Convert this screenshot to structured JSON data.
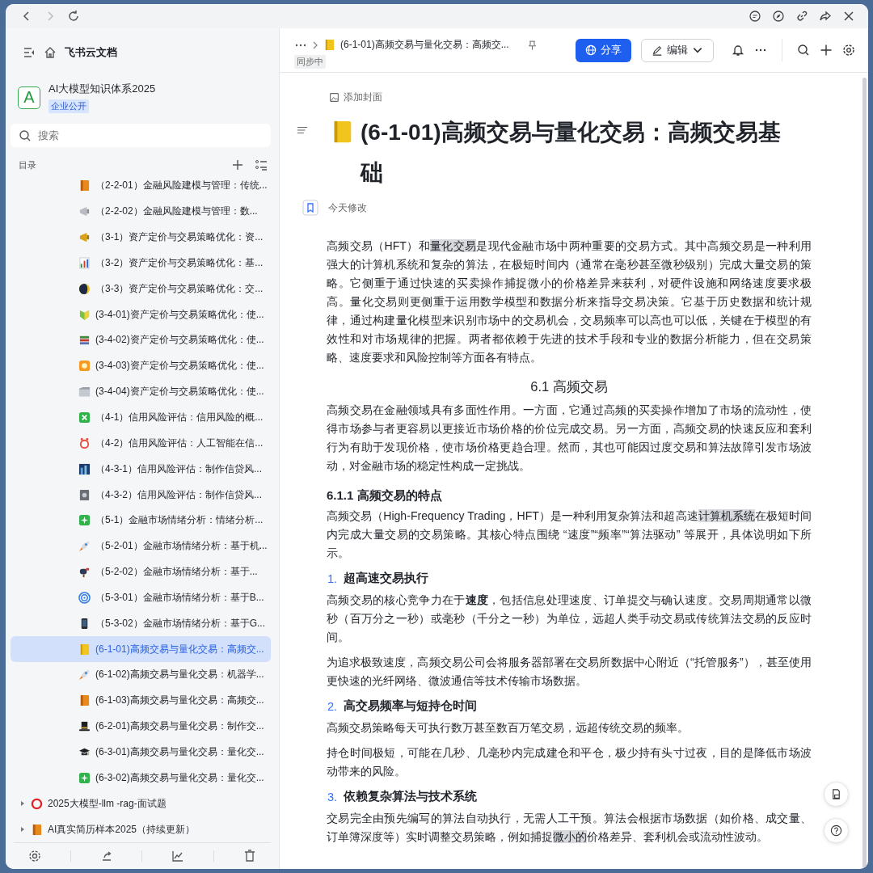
{
  "sidebar": {
    "app_title": "飞书云文档",
    "space": {
      "avatar": "A",
      "name": "AI大模型知识体系2025",
      "badge": "企业公开"
    },
    "search": {
      "placeholder": "搜索"
    },
    "toc_label": "目录",
    "items": [
      {
        "label": "（2-2-01）金融风险建模与管理：传统...",
        "selected": false
      },
      {
        "label": "（2-2-02）金融风险建模与管理：数...",
        "selected": false
      },
      {
        "label": "（3-1）资产定价与交易策略优化：资...",
        "selected": false
      },
      {
        "label": "（3-2）资产定价与交易策略优化：基...",
        "selected": false
      },
      {
        "label": "（3-3）资产定价与交易策略优化：交...",
        "selected": false
      },
      {
        "label": "(3-4-01)资产定价与交易策略优化：使...",
        "selected": false
      },
      {
        "label": "(3-4-02)资产定价与交易策略优化：使...",
        "selected": false
      },
      {
        "label": "(3-4-03)资产定价与交易策略优化：使...",
        "selected": false
      },
      {
        "label": "(3-4-04)资产定价与交易策略优化：使...",
        "selected": false
      },
      {
        "label": "（4-1）信用风险评估：信用风险的概...",
        "selected": false
      },
      {
        "label": "（4-2）信用风险评估：人工智能在信...",
        "selected": false
      },
      {
        "label": "（4-3-1）信用风险评估：制作信贷风...",
        "selected": false
      },
      {
        "label": "（4-3-2）信用风险评估：制作信贷风...",
        "selected": false
      },
      {
        "label": "（5-1）金融市场情绪分析：情绪分析...",
        "selected": false
      },
      {
        "label": "（5-2-01）金融市场情绪分析：基于机...",
        "selected": false
      },
      {
        "label": "（5-2-02）金融市场情绪分析：基于...",
        "selected": false
      },
      {
        "label": "（5-3-01）金融市场情绪分析：基于B...",
        "selected": false
      },
      {
        "label": "（5-3-02）金融市场情绪分析：基于G...",
        "selected": false
      },
      {
        "label": "(6-1-01)高频交易与量化交易：高频交...",
        "selected": true
      },
      {
        "label": "(6-1-02)高频交易与量化交易：机器学...",
        "selected": false
      },
      {
        "label": "(6-1-03)高频交易与量化交易：高频交...",
        "selected": false
      },
      {
        "label": "(6-2-01)高频交易与量化交易：制作交...",
        "selected": false
      },
      {
        "label": "(6-3-01)高频交易与量化交易：量化交...",
        "selected": false
      },
      {
        "label": "(6-3-02)高频交易与量化交易：量化交...",
        "selected": false
      }
    ],
    "tree": [
      {
        "label": "2025大模型-llm -rag-面试题",
        "expanded": false
      },
      {
        "label": "AI真实简历样本2025（持续更新）",
        "expanded": false
      }
    ]
  },
  "document": {
    "breadcrumb_title": "(6-1-01)高频交易与量化交易：高频交...",
    "sync_status": "同步中",
    "share_button": "分享",
    "edit_button": "编辑",
    "add_cover": "添加封面",
    "title": "(6-1-01)高频交易与量化交易：高频交易基础",
    "modified": "今天修改",
    "blocks": [
      {
        "kind": "paragraph",
        "segments": [
          {
            "text": "高频交易（HFT）和",
            "highlighted": false
          },
          {
            "text": "量化交易",
            "highlighted": true
          },
          {
            "text": "是现代金融市场中两种重要的交易方式。其中高频交易是一种利用强大的计算机系统和复杂的算法，在极短时间内（通常在毫秒甚至微秒级别）完成大量交易的策略。它侧重于通过快速的买卖操作捕捉微小的价格差异来获利，对硬件设施和网络速度要求极高。量化交易则更侧重于运用数学模型和数据分析来指导交易决策。它基于历史数据和统计规律，通过构建量化模型来识别市场中的交易机会，交易频率可以高也可以低，关键在于模型的有效性和对市场规律的把握。两者都依赖于先进的技术手段和专业的数据分析能力，但在交易策略、速度要求和风险控制等方面各有特点。",
            "highlighted": false
          }
        ]
      },
      {
        "kind": "heading2",
        "text": "6.1 高频交易"
      },
      {
        "kind": "paragraph",
        "segments": [
          {
            "text": "高频交易在金融领域具有多面性作用。一方面，它通过高频的买卖操作增加了市场的流动性，使得市场参与者更容易以更接近市场价格的价位完成交易。另一方面，高频交易的快速反应和套利行为有助于发现价格，使市场价格更趋合理。然而，其也可能因过度交易和算法故障引发市场波动，对金融市场的稳定性构成一定挑战。",
            "highlighted": false
          }
        ]
      },
      {
        "kind": "heading3",
        "text": "6.1.1  高频交易的特点"
      },
      {
        "kind": "paragraph",
        "segments": [
          {
            "text": "高频交易（High-Frequency Trading，HFT）是一种利用复杂算法和超高速",
            "highlighted": false
          },
          {
            "text": "计算机系统",
            "highlighted": true
          },
          {
            "text": "在极短时间内完成大量交易的交易策略。其核心特点围绕 “速度”“频率”“算法驱动” 等展开，具体说明如下所示。",
            "highlighted": false
          }
        ]
      },
      {
        "kind": "numbered",
        "number": "1.",
        "text": "超高速交易执行"
      },
      {
        "kind": "paragraph",
        "segments": [
          {
            "text": "高频交易的核心竞争力在于**速度**，包括信息处理速度、订单提交与确认速度。交易周期通常以微秒（百万分之一秒）或毫秒（千分之一秒）为单位，远超人类手动交易或传统算法交易的反应时间。",
            "highlighted": false
          }
        ]
      },
      {
        "kind": "paragraph",
        "segments": [
          {
            "text": "为追求极致速度，高频交易公司会将服务器部署在交易所数据中心附近（“托管服务”），甚至使用更快速的光纤网络、微波通信等技术传输市场数据。",
            "highlighted": false
          }
        ]
      },
      {
        "kind": "numbered",
        "number": "2.",
        "text": "高交易频率与短持仓时间"
      },
      {
        "kind": "paragraph",
        "segments": [
          {
            "text": "高频交易策略每天可执行数万甚至数百万笔交易，远超传统交易的频率。",
            "highlighted": false
          }
        ]
      },
      {
        "kind": "paragraph",
        "segments": [
          {
            "text": "持仓时间极短，可能在几秒、几毫秒内完成建仓和平仓，极少持有头寸过夜，目的是降低市场波动带来的风险。",
            "highlighted": false
          }
        ]
      },
      {
        "kind": "numbered",
        "number": "3.",
        "text": "依赖复杂算法与技术系统"
      },
      {
        "kind": "paragraph",
        "segments": [
          {
            "text": "交易完全由预先编写的算法自动执行，无需人工干预。算法会根据市场数据（如价格、成交量、订单簿深度等）实时调整交易策略，例如捕捉",
            "highlighted": false
          },
          {
            "text": "微小的",
            "highlighted": true
          },
          {
            "text": "价格差异、套利机会或流动性波动。",
            "highlighted": false
          }
        ]
      }
    ]
  }
}
